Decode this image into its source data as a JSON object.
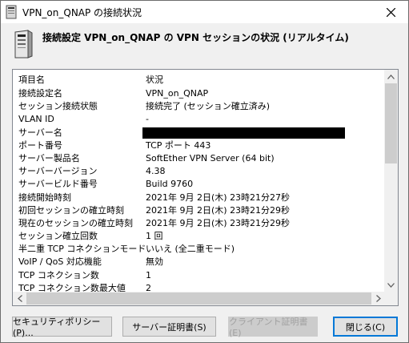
{
  "window": {
    "title": "VPN_on_QNAP の接続状況"
  },
  "header": {
    "text": "接続設定 VPN_on_QNAP の VPN セッションの状況 (リアルタイム)"
  },
  "list": {
    "columns": [
      "項目名",
      "状況"
    ],
    "rows": [
      {
        "name": "接続設定名",
        "value": "VPN_on_QNAP"
      },
      {
        "name": "セッション接続状態",
        "value": "接続完了 (セッション確立済み)"
      },
      {
        "name": "VLAN ID",
        "value": "-"
      },
      {
        "name": "サーバー名",
        "value": ""
      },
      {
        "name": "ポート番号",
        "value": "TCP ポート 443"
      },
      {
        "name": "サーバー製品名",
        "value": "SoftEther VPN Server (64 bit)"
      },
      {
        "name": "サーバーバージョン",
        "value": "4.38"
      },
      {
        "name": "サーバービルド番号",
        "value": "Build 9760"
      },
      {
        "name": "接続開始時刻",
        "value": "2021年 9月 2日(木) 23時21分27秒"
      },
      {
        "name": "初回セッションの確立時刻",
        "value": "2021年 9月 2日(木) 23時21分29秒"
      },
      {
        "name": "現在のセッションの確立時刻",
        "value": "2021年 9月 2日(木) 23時21分29秒"
      },
      {
        "name": "セッション確立回数",
        "value": "1 回"
      },
      {
        "name": "半二重 TCP コネクションモード",
        "value": "いいえ (全二重モード)"
      },
      {
        "name": "VoIP / QoS 対応機能",
        "value": "無効"
      },
      {
        "name": "TCP コネクション数",
        "value": "1"
      },
      {
        "name": "TCP コネクション数最大値",
        "value": "2"
      }
    ]
  },
  "buttons": {
    "security_policy": "セキュリティポリシー(P)...",
    "server_cert": "サーバー証明書(S)",
    "client_cert": "クライアント証明書(E)",
    "close": "閉じる(C)"
  },
  "icons": {
    "window": "server-icon",
    "header": "server-tower-icon",
    "close": "close-icon"
  }
}
